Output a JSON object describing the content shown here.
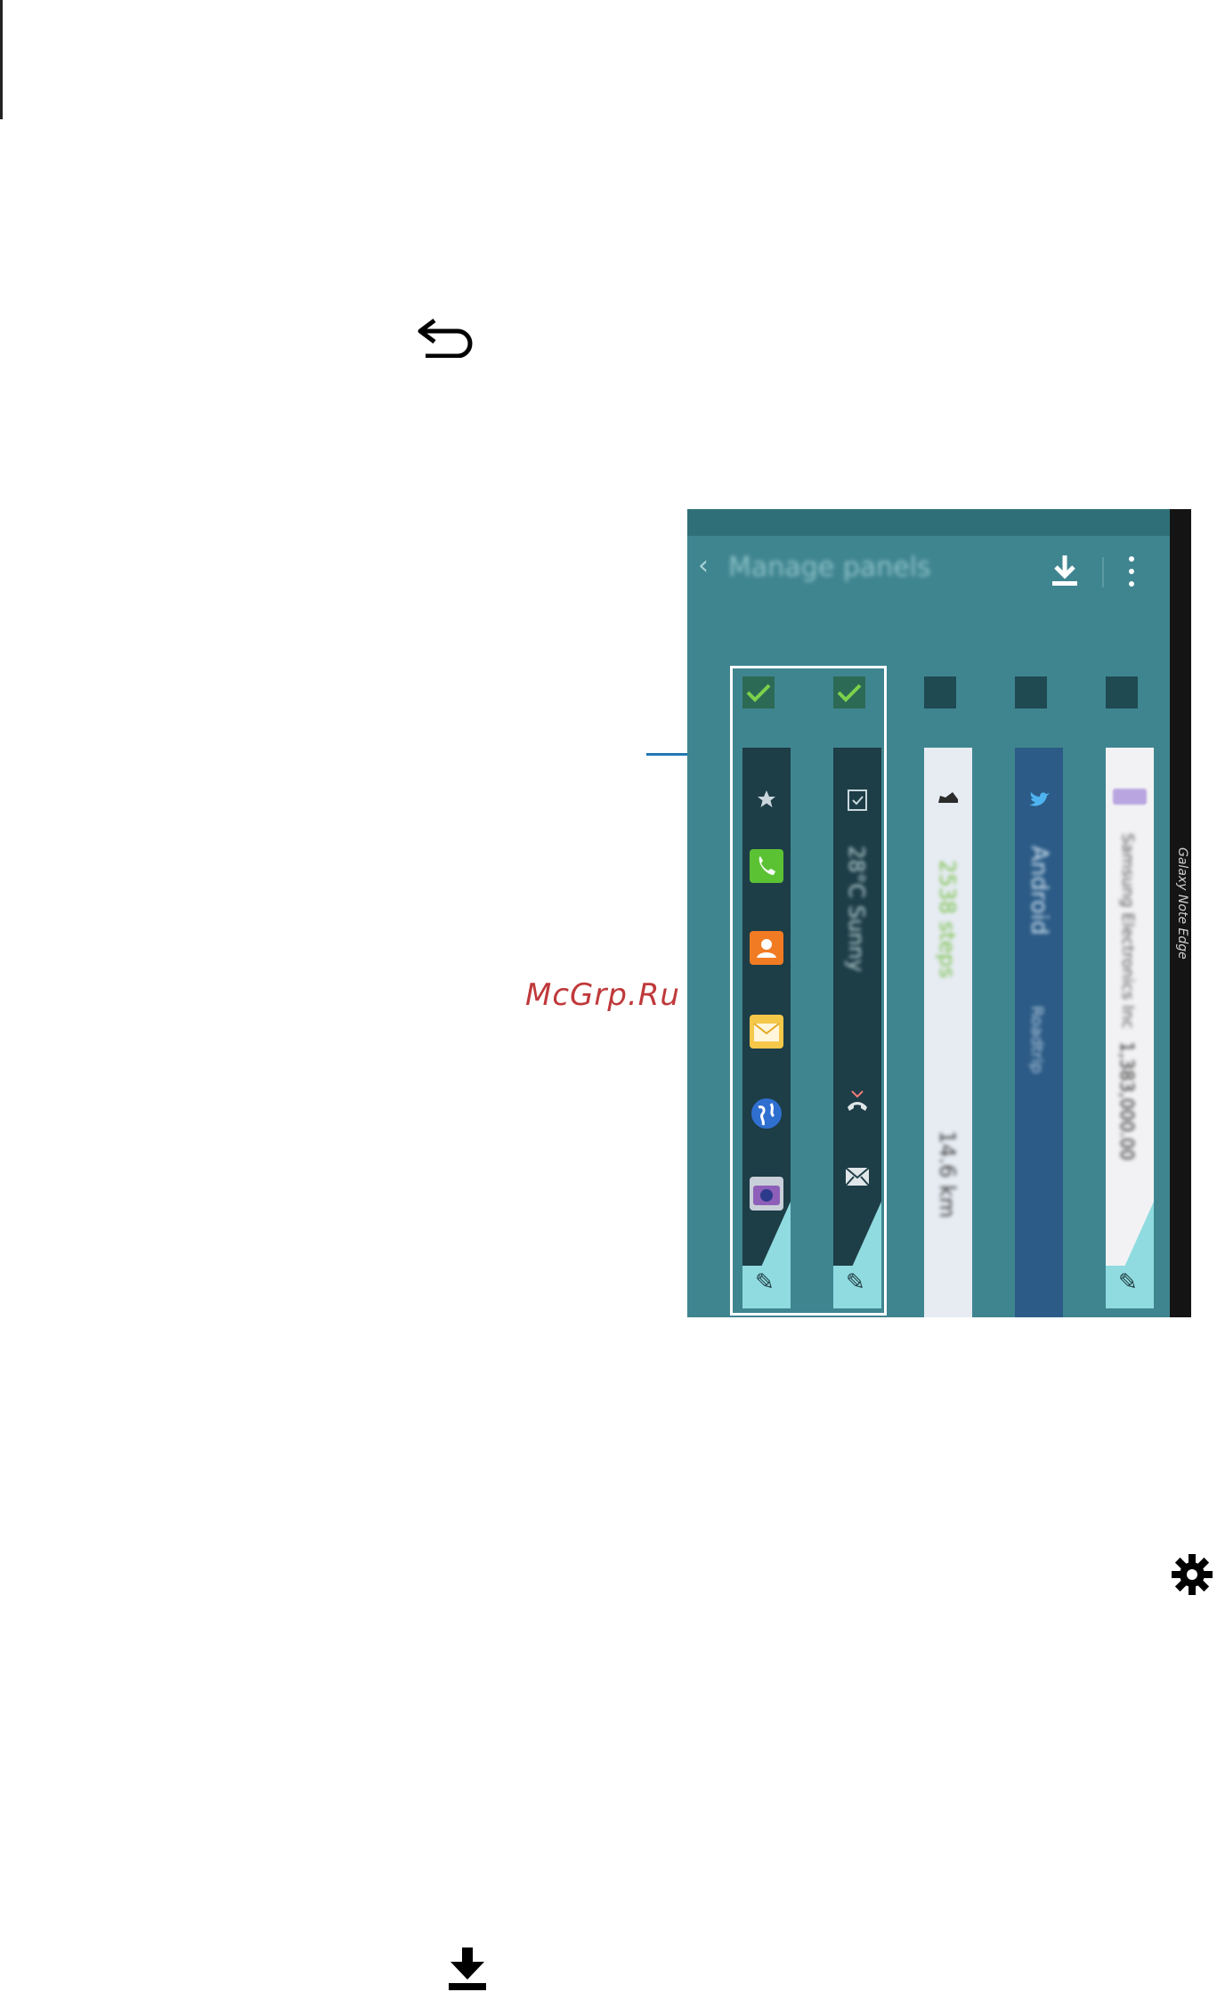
{
  "watermark": "McGrp.Ru",
  "phone": {
    "app_title": "Manage panels",
    "device_label": "Galaxy Note Edge",
    "panels": [
      {
        "type": "dark-apps",
        "checked": true
      },
      {
        "type": "dark-tasks",
        "checked": true,
        "text": "28°C Sunny"
      },
      {
        "type": "light-steps",
        "checked": false,
        "text1": "2538 steps",
        "text2": "14.6 km"
      },
      {
        "type": "blue-twitter",
        "checked": false,
        "text1": "Android",
        "text2": "Roadtrip"
      },
      {
        "type": "light-stocks",
        "checked": false,
        "text1": "Samsung Electronics Inc",
        "text2": "1,383,000.00"
      }
    ]
  },
  "icons": {
    "back": "undo-arrow-icon",
    "settings": "gear-icon",
    "download": "download-icon"
  },
  "colors": {
    "screen_bg": "#3f8590",
    "panel_dark": "#1d3d47",
    "accent_check": "#7bd14a",
    "callout": "#1f78b4",
    "watermark": "#c0393b"
  }
}
